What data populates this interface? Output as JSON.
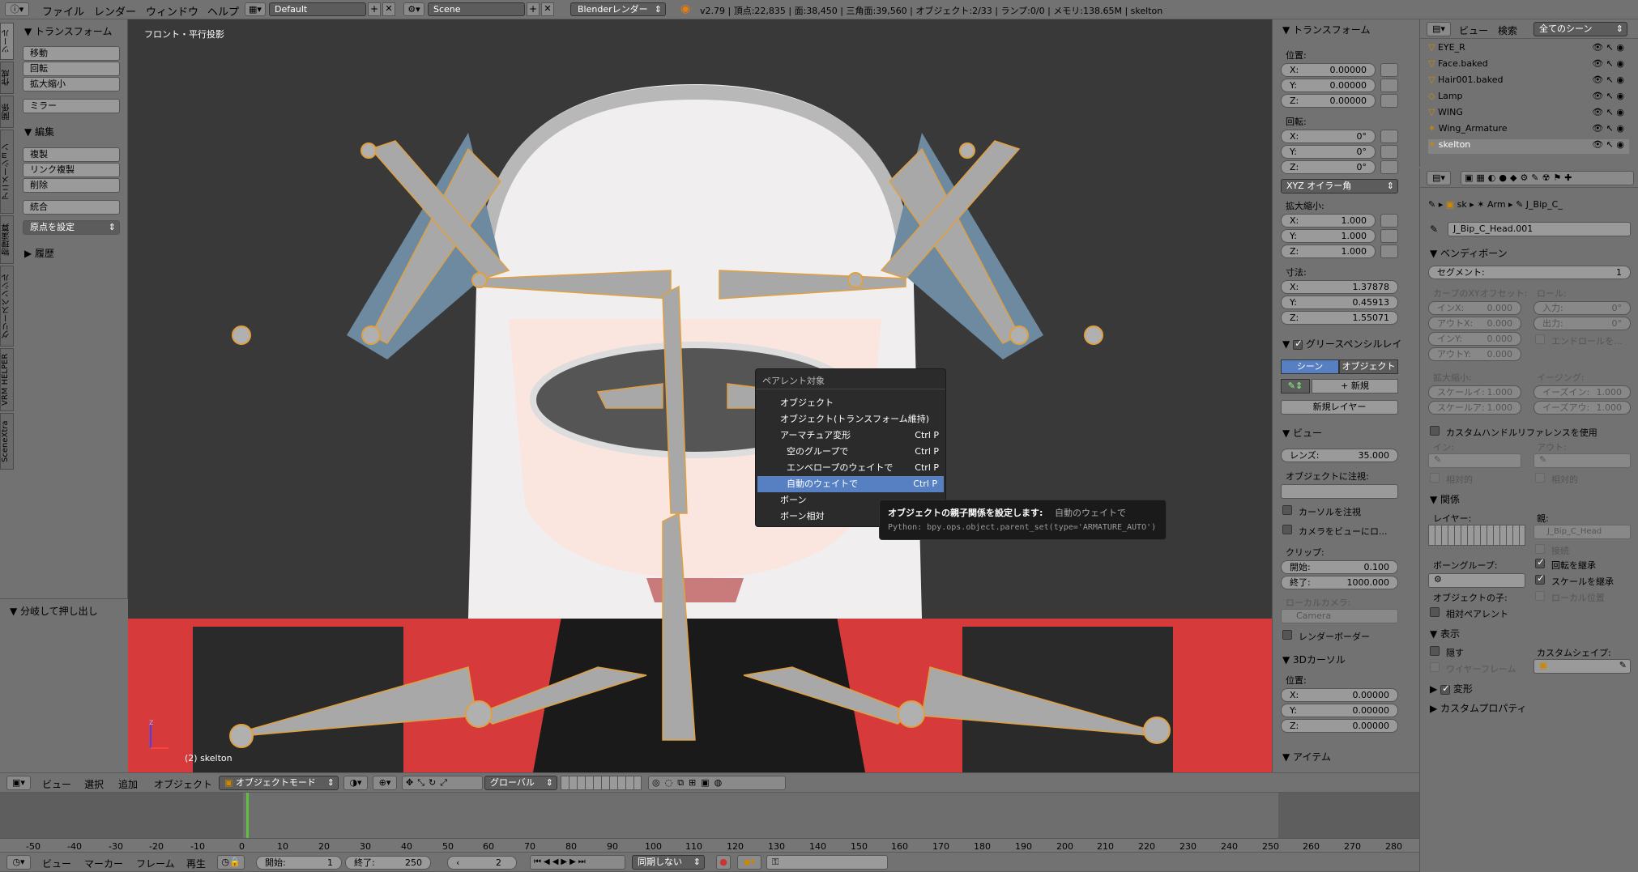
{
  "topbar": {
    "menus": [
      "ファイル",
      "レンダー",
      "ウィンドウ",
      "ヘルプ"
    ],
    "screen_layout": "Default",
    "scene": "Scene",
    "render_engine": "Blenderレンダー",
    "stats": "v2.79 | 頂点:22,835 | 面:38,450 | 三角面:39,560 | オブジェクト:2/33 | ランプ:0/0 | メモリ:138.65M | skelton"
  },
  "toolshelf": {
    "tabs": [
      "ツール",
      "作成",
      "関係",
      "アニメーション",
      "物理演算",
      "グリースペンシル",
      "VRM HELPER",
      "SceneXtra"
    ],
    "transform_header": "トランスフォーム",
    "transform_buttons": [
      "移動",
      "回転",
      "拡大縮小"
    ],
    "mirror": "ミラー",
    "edit_header": "編集",
    "edit_buttons": [
      "複製",
      "リンク複製",
      "削除"
    ],
    "join": "統合",
    "origin": "原点を設定",
    "history_header": "履歴",
    "operator_panel": "分岐して押し出し"
  },
  "viewport": {
    "view_label": "フロント・平行投影",
    "object_label": "(2) skelton",
    "axis_z": "z"
  },
  "parent_menu": {
    "title": "ペアレント対象",
    "items": [
      {
        "label": "オブジェクト",
        "shortcut": ""
      },
      {
        "label": "オブジェクト(トランスフォーム維持)",
        "shortcut": ""
      },
      {
        "label": "アーマチュア変形",
        "shortcut": "Ctrl P"
      },
      {
        "label": "空のグループで",
        "shortcut": "Ctrl P"
      },
      {
        "label": "エンベロープのウェイトで",
        "shortcut": "Ctrl P"
      },
      {
        "label": "自動のウェイトで",
        "shortcut": "Ctrl P"
      },
      {
        "label": "ボーン",
        "shortcut": ""
      },
      {
        "label": "ボーン相対",
        "shortcut": ""
      }
    ],
    "highlight_index": 5
  },
  "tooltip": {
    "title": "オブジェクトの親子関係を設定します:",
    "value": "自動のウェイトで",
    "python": "Python: bpy.ops.object.parent_set(type='ARMATURE_AUTO')"
  },
  "properties_n": {
    "transform_header": "トランスフォーム",
    "location_label": "位置:",
    "location": [
      {
        "k": "X:",
        "v": "0.00000"
      },
      {
        "k": "Y:",
        "v": "0.00000"
      },
      {
        "k": "Z:",
        "v": "0.00000"
      }
    ],
    "rotation_label": "回転:",
    "rotation": [
      {
        "k": "X:",
        "v": "0°"
      },
      {
        "k": "Y:",
        "v": "0°"
      },
      {
        "k": "Z:",
        "v": "0°"
      }
    ],
    "rotation_mode": "XYZ オイラー角",
    "scale_label": "拡大縮小:",
    "scale": [
      {
        "k": "X:",
        "v": "1.000"
      },
      {
        "k": "Y:",
        "v": "1.000"
      },
      {
        "k": "Z:",
        "v": "1.000"
      }
    ],
    "dimensions_label": "寸法:",
    "dimensions": [
      {
        "k": "X:",
        "v": "1.37878"
      },
      {
        "k": "Y:",
        "v": "0.45913"
      },
      {
        "k": "Z:",
        "v": "1.55071"
      }
    ],
    "grease_header": "グリースペンシルレイ",
    "scene_btn": "シーン",
    "object_btn": "オブジェクト",
    "new_btn": "新規",
    "new_layer_btn": "新規レイヤー",
    "view_header": "ビュー",
    "lens_label": "レンズ:",
    "lens_value": "35.000",
    "lock_to_object": "オブジェクトに注視:",
    "lock_cursor": "カーソルを注視",
    "lock_camera": "カメラをビューにロ...",
    "clip_label": "クリップ:",
    "clip_start_k": "開始:",
    "clip_start_v": "0.100",
    "clip_end_k": "終了:",
    "clip_end_v": "1000.000",
    "local_camera": "ローカルカメラ:",
    "camera_name": "Camera",
    "render_border": "レンダーボーダー",
    "cursor_header": "3Dカーソル",
    "cursor_location_label": "位置:",
    "cursor": [
      {
        "k": "X:",
        "v": "0.00000"
      },
      {
        "k": "Y:",
        "v": "0.00000"
      },
      {
        "k": "Z:",
        "v": "0.00000"
      }
    ],
    "item_header": "アイテム"
  },
  "outliner": {
    "menus": [
      "ビュー",
      "検索"
    ],
    "filter": "全てのシーン",
    "items": [
      "EYE_R",
      "Face.baked",
      "Hair001.baked",
      "Lamp",
      "WING",
      "Wing_Armature",
      "skelton"
    ]
  },
  "bone_props": {
    "breadcrumb": [
      "sk",
      "Arm",
      "J_Bip_C_"
    ],
    "bone_name": "J_Bip_C_Head.001",
    "bendy_header": "ベンディボーン",
    "segments_label": "セグメント:",
    "segments_value": "1",
    "curve_offset_label": "カーブのXYオフセット:",
    "roll_label": "ロール:",
    "in_x": "インX:",
    "in_x_v": "0.000",
    "out_x": "アウトX:",
    "out_x_v": "0.000",
    "in_y": "インY:",
    "in_y_v": "0.000",
    "out_y": "アウトY:",
    "out_y_v": "0.000",
    "roll_in": "入力:",
    "roll_in_v": "0°",
    "roll_out": "出力:",
    "roll_out_v": "0°",
    "end_roll": "エンドロールを...",
    "scale_label": "拡大縮小:",
    "easing_label": "イージング:",
    "scale_in": "スケールイ:",
    "scale_in_v": "1.000",
    "scale_out": "スケールア:",
    "scale_out_v": "1.000",
    "ease_in": "イーズイン:",
    "ease_in_v": "1.000",
    "ease_out": "イーズアウ:",
    "ease_out_v": "1.000",
    "custom_handle": "カスタムハンドルリファレンスを使用",
    "in_label": "イン:",
    "out_label": "アウト:",
    "relative": "相対的",
    "relations_header": "関係",
    "layers_label": "レイヤー:",
    "parent_label": "親:",
    "parent_value": "J_Bip_C_Head",
    "connected": "接続",
    "bone_group": "ボーングループ:",
    "inherit_rot": "回転を継承",
    "inherit_scale": "スケールを継承",
    "object_children": "オブジェクトの子:",
    "local_location": "ローカル位置",
    "relative_parent": "相対ペアレント",
    "display_header": "表示",
    "hide": "隠す",
    "custom_shape": "カスタムシェイプ:",
    "wireframe": "ワイヤーフレーム",
    "deform_header": "変形",
    "custom_props_header": "カスタムプロパティ"
  },
  "view3d_header": {
    "menus": [
      "ビュー",
      "選択",
      "追加",
      "オブジェクト"
    ],
    "mode": "オブジェクトモード",
    "orientation": "グローバル"
  },
  "timeline": {
    "ticks": [
      "-50",
      "-40",
      "-30",
      "-20",
      "-10",
      "0",
      "10",
      "20",
      "30",
      "40",
      "50",
      "60",
      "70",
      "80",
      "90",
      "100",
      "110",
      "120",
      "130",
      "140",
      "150",
      "160",
      "170",
      "180",
      "190",
      "200",
      "210",
      "220",
      "230",
      "240",
      "250",
      "260",
      "270",
      "280"
    ],
    "menus": [
      "ビュー",
      "マーカー",
      "フレーム",
      "再生"
    ],
    "start_label": "開始:",
    "start_value": "1",
    "end_label": "終了:",
    "end_value": "250",
    "current": "2",
    "sync": "同期しない"
  }
}
